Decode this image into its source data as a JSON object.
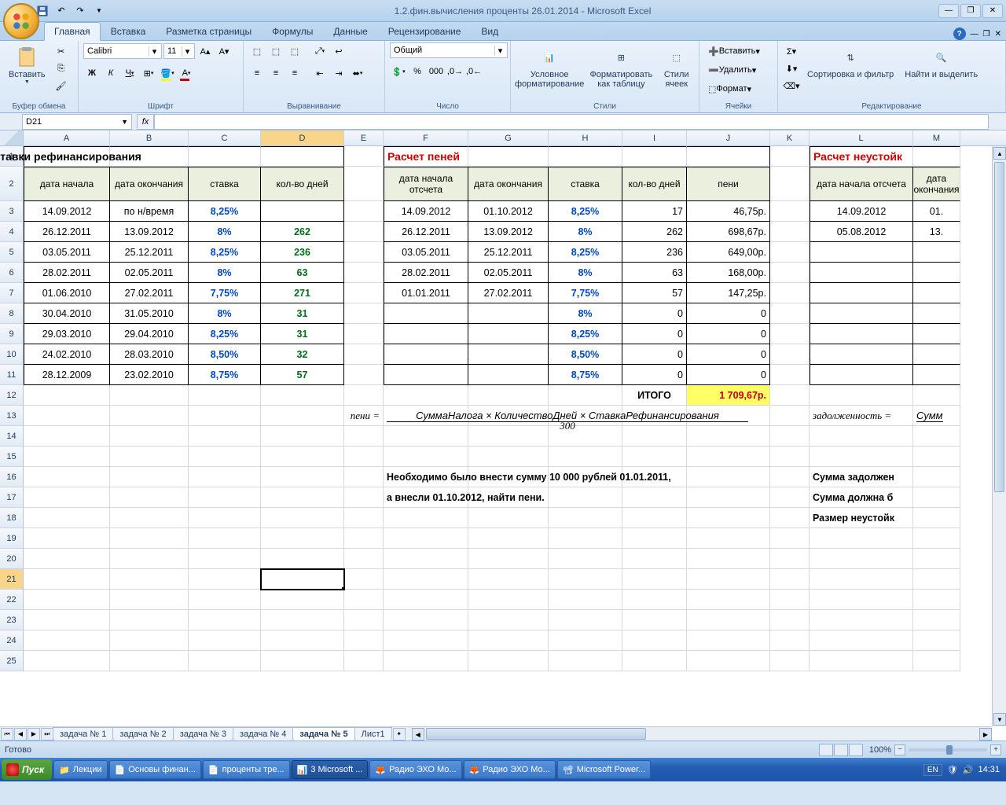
{
  "title": "1.2.фин.вычисления проценты 26.01.2014 - Microsoft Excel",
  "tabs": [
    "Главная",
    "Вставка",
    "Разметка страницы",
    "Формулы",
    "Данные",
    "Рецензирование",
    "Вид"
  ],
  "active_tab": 0,
  "ribbon": {
    "clipboard": {
      "paste": "Вставить",
      "label": "Буфер обмена"
    },
    "font": {
      "name": "Calibri",
      "size": "11",
      "label": "Шрифт"
    },
    "align": {
      "label": "Выравнивание"
    },
    "number": {
      "format": "Общий",
      "label": "Число"
    },
    "styles": {
      "cond": "Условное форматирование",
      "table": "Форматировать как таблицу",
      "cell": "Стили ячеек",
      "label": "Стили"
    },
    "cells": {
      "insert": "Вставить",
      "delete": "Удалить",
      "format": "Формат",
      "label": "Ячейки"
    },
    "editing": {
      "sort": "Сортировка и фильтр",
      "find": "Найти и выделить",
      "label": "Редактирование"
    }
  },
  "namebox": "D21",
  "columns": [
    "A",
    "B",
    "C",
    "D",
    "E",
    "F",
    "G",
    "H",
    "I",
    "J",
    "K",
    "L",
    "M"
  ],
  "titles": {
    "t1": "Ставки рефинансирования",
    "t2": "Расчет пеней",
    "t3": "Расчет неустойк"
  },
  "headers": {
    "a": "дата начала",
    "b": "дата окончания",
    "c": "ставка",
    "d": "кол-во дней",
    "f": "дата начала отсчета",
    "g": "дата окончания",
    "h": "ставка",
    "i": "кол-во дней",
    "j": "пени",
    "l": "дата начала отсчета",
    "m": "дата окончания"
  },
  "table1": [
    {
      "a": "14.09.2012",
      "b": "по н/время",
      "c": "8,25%",
      "d": ""
    },
    {
      "a": "26.12.2011",
      "b": "13.09.2012",
      "c": "8%",
      "d": "262"
    },
    {
      "a": "03.05.2011",
      "b": "25.12.2011",
      "c": "8,25%",
      "d": "236"
    },
    {
      "a": "28.02.2011",
      "b": "02.05.2011",
      "c": "8%",
      "d": "63"
    },
    {
      "a": "01.06.2010",
      "b": "27.02.2011",
      "c": "7,75%",
      "d": "271"
    },
    {
      "a": "30.04.2010",
      "b": "31.05.2010",
      "c": "8%",
      "d": "31"
    },
    {
      "a": "29.03.2010",
      "b": "29.04.2010",
      "c": "8,25%",
      "d": "31"
    },
    {
      "a": "24.02.2010",
      "b": "28.03.2010",
      "c": "8,50%",
      "d": "32"
    },
    {
      "a": "28.12.2009",
      "b": "23.02.2010",
      "c": "8,75%",
      "d": "57"
    }
  ],
  "table2": [
    {
      "f": "14.09.2012",
      "g": "01.10.2012",
      "h": "8,25%",
      "i": "17",
      "j": "46,75р."
    },
    {
      "f": "26.12.2011",
      "g": "13.09.2012",
      "h": "8%",
      "i": "262",
      "j": "698,67р."
    },
    {
      "f": "03.05.2011",
      "g": "25.12.2011",
      "h": "8,25%",
      "i": "236",
      "j": "649,00р."
    },
    {
      "f": "28.02.2011",
      "g": "02.05.2011",
      "h": "8%",
      "i": "63",
      "j": "168,00р."
    },
    {
      "f": "01.01.2011",
      "g": "27.02.2011",
      "h": "7,75%",
      "i": "57",
      "j": "147,25р."
    },
    {
      "f": "",
      "g": "",
      "h": "8%",
      "i": "0",
      "j": "0"
    },
    {
      "f": "",
      "g": "",
      "h": "8,25%",
      "i": "0",
      "j": "0"
    },
    {
      "f": "",
      "g": "",
      "h": "8,50%",
      "i": "0",
      "j": "0"
    },
    {
      "f": "",
      "g": "",
      "h": "8,75%",
      "i": "0",
      "j": "0"
    }
  ],
  "table3": [
    {
      "l": "14.09.2012",
      "m": "01."
    },
    {
      "l": "05.08.2012",
      "m": "13."
    }
  ],
  "itogo_label": "ИТОГО",
  "itogo_value": "1 709,67р.",
  "formula_left": "пени =",
  "formula_num": "СуммаНалога × КоличествоДней × СтавкаРефинансирования",
  "formula_den": "300",
  "formula2_left": "задолженность =",
  "formula2_num": "Сумм",
  "text_lines": {
    "l1": "Необходимо было внести сумму 10 000 рублей 01.01.2011,",
    "l2": "а внесли 01.10.2012, найти пени.",
    "r1": "Сумма задолжен",
    "r2": "Сумма должна б",
    "r3": "Размер неустойк"
  },
  "sheets": [
    "задача № 1",
    "задача № 2",
    "задача № 3",
    "задача № 4",
    "задача № 5",
    "Лист1"
  ],
  "active_sheet": 4,
  "status": "Готово",
  "zoom": "100%",
  "taskbar": {
    "start": "Пуск",
    "items": [
      "Лекции",
      "Основы финан...",
      "проценты тре...",
      "3 Microsoft ...",
      "Радио ЭХО Мо...",
      "Радио ЭХО Мо...",
      "Microsoft Power..."
    ],
    "active_item": 3,
    "lang": "EN",
    "time": "14:31"
  }
}
